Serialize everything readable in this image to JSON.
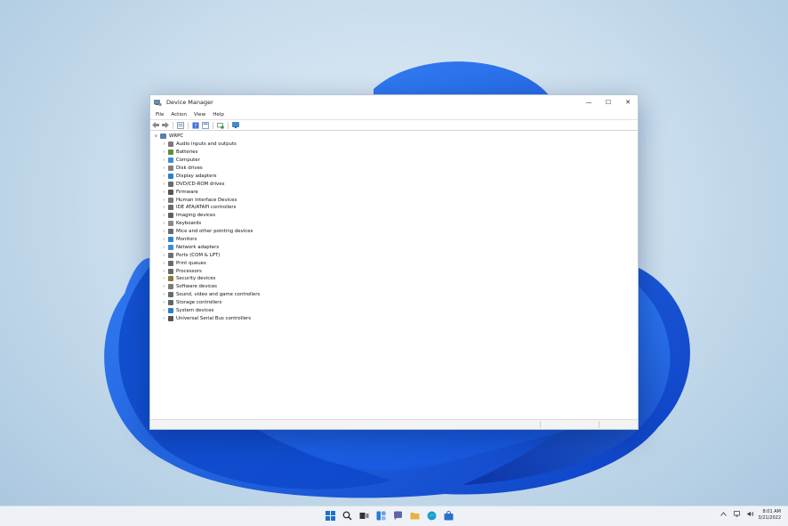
{
  "window": {
    "title": "Device Manager",
    "controls": {
      "minimize": "—",
      "maximize": "☐",
      "close": "✕"
    }
  },
  "menu": [
    "File",
    "Action",
    "View",
    "Help"
  ],
  "toolbar": {
    "icons": [
      "back-arrow-icon",
      "forward-arrow-icon",
      "properties-icon",
      "help-icon",
      "view-icon",
      "scan-icon",
      "monitor-icon"
    ]
  },
  "tree": {
    "root": {
      "label": "WRPC",
      "expanded": "∨"
    },
    "collapsed_glyph": "›",
    "items": [
      {
        "label": "Audio inputs and outputs",
        "icon": "speaker-icon",
        "color": "#7a7a7a"
      },
      {
        "label": "Batteries",
        "icon": "battery-icon",
        "color": "#5a8f3c"
      },
      {
        "label": "Computer",
        "icon": "computer-icon",
        "color": "#3b8fd8"
      },
      {
        "label": "Disk drives",
        "icon": "disk-icon",
        "color": "#808080"
      },
      {
        "label": "Display adapters",
        "icon": "display-icon",
        "color": "#2b7fc8"
      },
      {
        "label": "DVD/CD-ROM drives",
        "icon": "dvd-icon",
        "color": "#6a6a6a"
      },
      {
        "label": "Firmware",
        "icon": "firmware-icon",
        "color": "#555555"
      },
      {
        "label": "Human Interface Devices",
        "icon": "hid-icon",
        "color": "#7a7a7a"
      },
      {
        "label": "IDE ATA/ATAPI controllers",
        "icon": "ide-icon",
        "color": "#6d6d6d"
      },
      {
        "label": "Imaging devices",
        "icon": "camera-icon",
        "color": "#606060"
      },
      {
        "label": "Keyboards",
        "icon": "keyboard-icon",
        "color": "#8a8a8a"
      },
      {
        "label": "Mice and other pointing devices",
        "icon": "mouse-icon",
        "color": "#6a6a6a"
      },
      {
        "label": "Monitors",
        "icon": "monitor-icon",
        "color": "#2f86d2"
      },
      {
        "label": "Network adapters",
        "icon": "network-icon",
        "color": "#3a8ed8"
      },
      {
        "label": "Ports (COM & LPT)",
        "icon": "port-icon",
        "color": "#707070"
      },
      {
        "label": "Print queues",
        "icon": "printer-icon",
        "color": "#6b6b6b"
      },
      {
        "label": "Processors",
        "icon": "processor-icon",
        "color": "#5f6f5f"
      },
      {
        "label": "Security devices",
        "icon": "security-icon",
        "color": "#8a7a3c"
      },
      {
        "label": "Software devices",
        "icon": "software-icon",
        "color": "#7a7a7a"
      },
      {
        "label": "Sound, video and game controllers",
        "icon": "sound-icon",
        "color": "#6a6a6a"
      },
      {
        "label": "Storage controllers",
        "icon": "storage-icon",
        "color": "#5a6a6a"
      },
      {
        "label": "System devices",
        "icon": "system-icon",
        "color": "#2f7fc6"
      },
      {
        "label": "Universal Serial Bus controllers",
        "icon": "usb-icon",
        "color": "#555555"
      }
    ]
  },
  "taskbar": {
    "icons": [
      {
        "name": "start-icon",
        "color": "#1f6fd1"
      },
      {
        "name": "search-icon",
        "color": "#222222"
      },
      {
        "name": "task-view-icon",
        "color": "#333333"
      },
      {
        "name": "widgets-icon",
        "color": "#2a7bd6"
      },
      {
        "name": "chat-icon",
        "color": "#6264a7"
      },
      {
        "name": "file-explorer-icon",
        "color": "#e8b23c"
      },
      {
        "name": "edge-icon",
        "color": "#1b9bd8"
      },
      {
        "name": "store-icon",
        "color": "#2a6fcf"
      }
    ],
    "tray": [
      "chevron-up-icon",
      "network-icon",
      "volume-icon"
    ],
    "time": "8:01 AM",
    "date": "3/21/2022"
  },
  "colors": {
    "accent": "#1f6fd1",
    "wallpaper": "#1e5fd6"
  }
}
